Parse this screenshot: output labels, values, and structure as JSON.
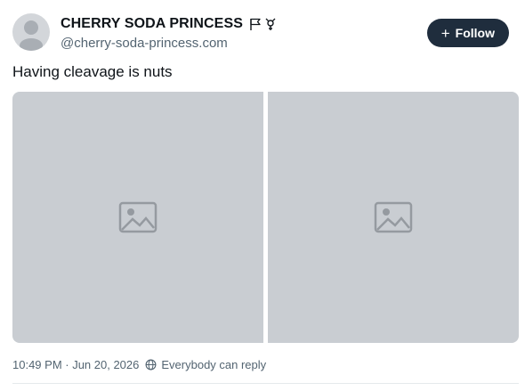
{
  "author": {
    "display_name": "CHERRY SODA PRINCESS",
    "handle": "@cherry-soda-princess.com",
    "name_icons": [
      "flag-outline-icon",
      "gender-symbol-icon"
    ]
  },
  "follow_button": {
    "label": "Follow",
    "icon": "plus-icon",
    "background": "#1f2d3d"
  },
  "post": {
    "text": "Having cleavage is nuts",
    "images": [
      {
        "placeholder": "image-placeholder-icon"
      },
      {
        "placeholder": "image-placeholder-icon"
      }
    ]
  },
  "footer": {
    "timestamp": "10:49 PM · Jun 20, 2026",
    "reply_setting": "Everybody can reply",
    "reply_icon": "globe-icon"
  },
  "colors": {
    "text": "#0f1419",
    "secondary_text": "#536471",
    "divider": "#e5e9ec"
  }
}
